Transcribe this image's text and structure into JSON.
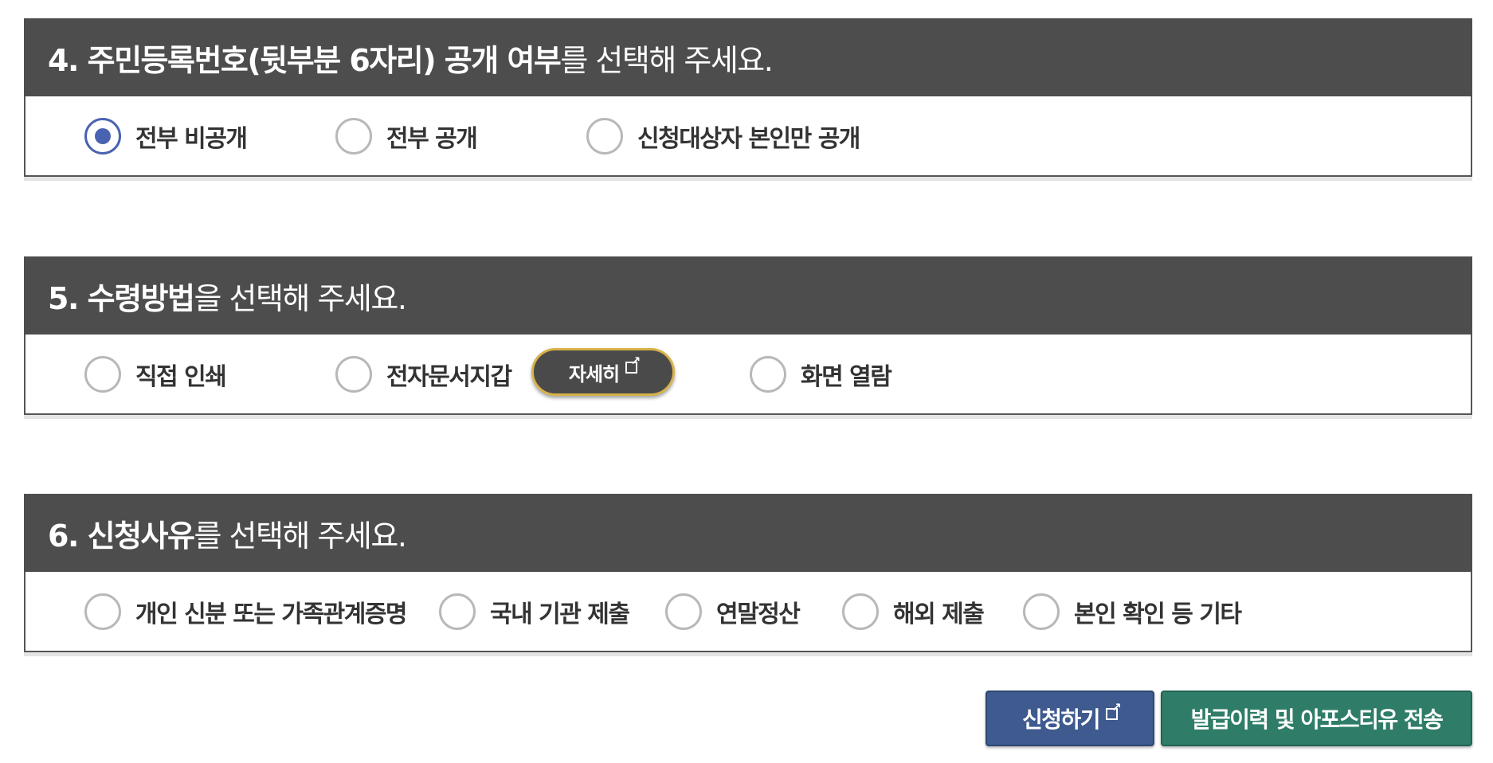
{
  "sections": [
    {
      "title_bold": "4. 주민등록번호(뒷부분 6자리) 공개 여부",
      "title_rest": "를 선택해 주세요.",
      "options": [
        {
          "label": "전부 비공개",
          "checked": true
        },
        {
          "label": "전부 공개",
          "checked": false
        },
        {
          "label": "신청대상자 본인만 공개",
          "checked": false
        }
      ]
    },
    {
      "title_bold": "5. 수령방법",
      "title_rest": "을 선택해 주세요.",
      "options": [
        {
          "label": "직접 인쇄",
          "checked": false
        },
        {
          "label": "전자문서지갑",
          "checked": false
        },
        {
          "label": "화면 열람",
          "checked": false
        }
      ],
      "detail_button": {
        "label": "자세히",
        "icon": "external-link-icon"
      }
    },
    {
      "title_bold": "6. 신청사유",
      "title_rest": "를 선택해 주세요.",
      "options": [
        {
          "label": "개인 신분 또는 가족관계증명",
          "checked": false
        },
        {
          "label": "국내 기관 제출",
          "checked": false
        },
        {
          "label": "연말정산",
          "checked": false
        },
        {
          "label": "해외 제출",
          "checked": false
        },
        {
          "label": "본인 확인 등 기타",
          "checked": false
        }
      ]
    }
  ],
  "buttons": {
    "apply": {
      "label": "신청하기",
      "icon": "external-link-icon",
      "color": "#3e5a8f"
    },
    "send": {
      "label": "발급이력 및 아포스티유 전송",
      "color": "#2f7d68"
    }
  },
  "colors": {
    "header_bg": "#4d4d4d",
    "radio_selected": "#4a63b0",
    "detail_button_border": "#d8b24a"
  }
}
